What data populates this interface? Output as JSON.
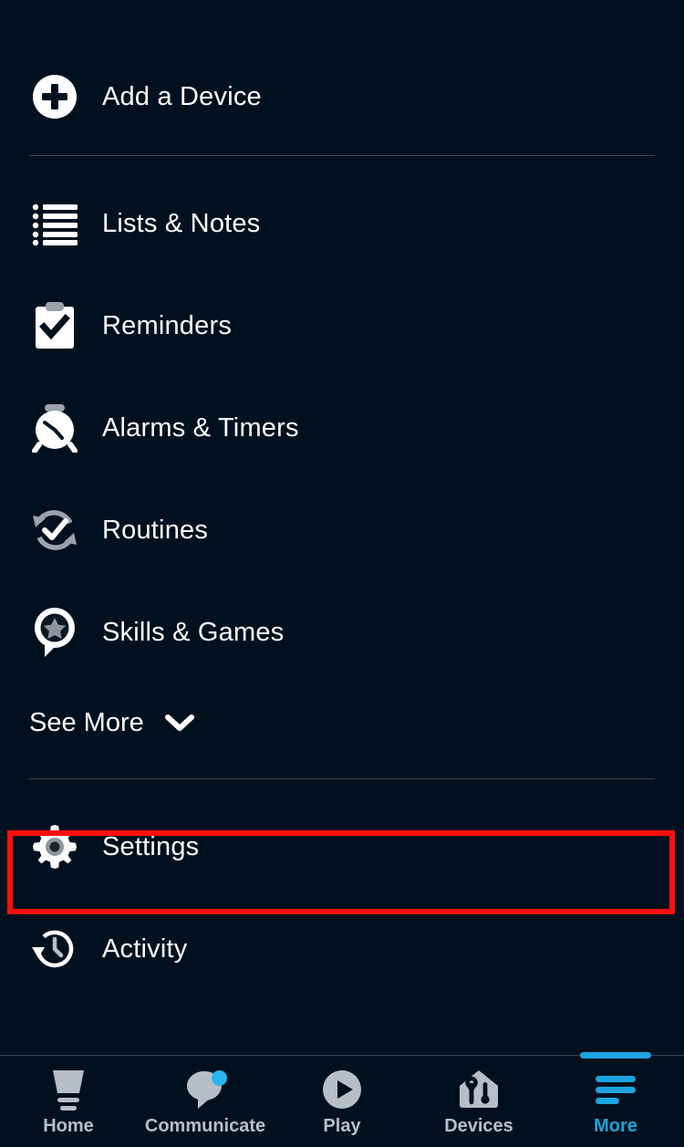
{
  "app": {
    "background_color": "#00101e",
    "accent_color": "#1ca5e0",
    "highlight_color": "#ff0f0f",
    "icon_color": "#ffffff",
    "muted_icon_color": "#aab3bd"
  },
  "menu": {
    "add_device": {
      "label": "Add a Device",
      "icon": "plus-circle-icon"
    },
    "items": [
      {
        "label": "Lists & Notes",
        "icon": "list-icon"
      },
      {
        "label": "Reminders",
        "icon": "clipboard-check-icon"
      },
      {
        "label": "Alarms & Timers",
        "icon": "alarm-clock-icon"
      },
      {
        "label": "Routines",
        "icon": "refresh-check-icon"
      },
      {
        "label": "Skills & Games",
        "icon": "pin-star-icon"
      }
    ],
    "see_more": {
      "label": "See More",
      "icon": "chevron-down-icon"
    },
    "lower_items": [
      {
        "label": "Settings",
        "icon": "gear-icon",
        "highlighted": true
      },
      {
        "label": "Activity",
        "icon": "history-clock-icon",
        "highlighted": false
      }
    ]
  },
  "bottom_nav": {
    "items": [
      {
        "label": "Home",
        "icon": "echo-speaker-icon",
        "active": false,
        "badge": false
      },
      {
        "label": "Communicate",
        "icon": "speech-bubble-icon",
        "active": false,
        "badge": true
      },
      {
        "label": "Play",
        "icon": "play-circle-icon",
        "active": false,
        "badge": false
      },
      {
        "label": "Devices",
        "icon": "home-devices-icon",
        "active": false,
        "badge": false
      },
      {
        "label": "More",
        "icon": "hamburger-icon",
        "active": true,
        "badge": false
      }
    ]
  }
}
